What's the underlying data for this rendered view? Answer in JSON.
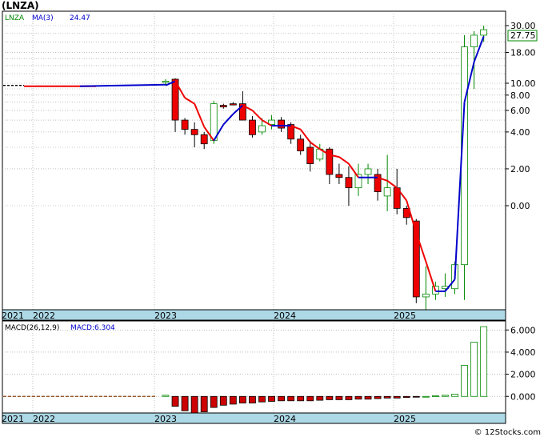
{
  "page": {
    "title": "(LNZA)",
    "copyright": "© 12Stocks.com"
  },
  "chart_data": [
    {
      "type": "candlestick",
      "ticker_label": "LNZA",
      "ma_label": "MA(3)",
      "ma_value": "24.47",
      "last_price": "27.75",
      "y_scale": "log",
      "y_ticks": [
        {
          "label": "30.00",
          "v": 30
        },
        {
          "label": "18.00",
          "v": 18
        },
        {
          "label": "10.00",
          "v": 10
        },
        {
          "label": "8.00",
          "v": 8
        },
        {
          "label": "6.00",
          "v": 6
        },
        {
          "label": "4.00",
          "v": 4
        },
        {
          "label": "2.00",
          "v": 2
        },
        {
          "label": "0.00",
          "v": 1
        }
      ],
      "x_ticks": [
        "2021",
        "2022",
        "2023",
        "2024",
        "2025"
      ],
      "flat_price_2021_2022": 9.6,
      "candles": [
        {
          "o": 10.2,
          "h": 10.8,
          "l": 9.6,
          "c": 10.4
        },
        {
          "o": 10.8,
          "h": 11.0,
          "l": 4.0,
          "c": 5.0
        },
        {
          "o": 5.0,
          "h": 5.2,
          "l": 3.8,
          "c": 4.2
        },
        {
          "o": 4.2,
          "h": 4.8,
          "l": 3.0,
          "c": 3.8
        },
        {
          "o": 3.8,
          "h": 4.0,
          "l": 2.9,
          "c": 3.2
        },
        {
          "o": 3.4,
          "h": 7.2,
          "l": 3.2,
          "c": 6.8
        },
        {
          "o": 6.6,
          "h": 6.8,
          "l": 6.2,
          "c": 6.4
        },
        {
          "o": 6.8,
          "h": 7.0,
          "l": 6.6,
          "c": 6.7
        },
        {
          "o": 6.8,
          "h": 8.6,
          "l": 5.0,
          "c": 5.0
        },
        {
          "o": 5.0,
          "h": 5.4,
          "l": 3.6,
          "c": 3.8
        },
        {
          "o": 4.0,
          "h": 5.2,
          "l": 3.8,
          "c": 4.5
        },
        {
          "o": 4.6,
          "h": 5.5,
          "l": 4.2,
          "c": 5.0
        },
        {
          "o": 5.0,
          "h": 5.3,
          "l": 4.0,
          "c": 4.3
        },
        {
          "o": 4.6,
          "h": 4.8,
          "l": 3.2,
          "c": 3.5
        },
        {
          "o": 3.5,
          "h": 3.8,
          "l": 2.6,
          "c": 2.8
        },
        {
          "o": 3.0,
          "h": 3.4,
          "l": 1.9,
          "c": 2.2
        },
        {
          "o": 2.4,
          "h": 3.2,
          "l": 2.3,
          "c": 2.9
        },
        {
          "o": 2.9,
          "h": 3.0,
          "l": 1.5,
          "c": 1.8
        },
        {
          "o": 1.8,
          "h": 2.2,
          "l": 1.5,
          "c": 1.7
        },
        {
          "o": 1.7,
          "h": 2.1,
          "l": 1.0,
          "c": 1.4
        },
        {
          "o": 1.4,
          "h": 2.2,
          "l": 1.2,
          "c": 1.8
        },
        {
          "o": 1.8,
          "h": 2.2,
          "l": 1.5,
          "c": 2.0
        },
        {
          "o": 1.8,
          "h": 2.0,
          "l": 1.1,
          "c": 1.3
        },
        {
          "o": 1.2,
          "h": 2.6,
          "l": 0.9,
          "c": 1.4
        },
        {
          "o": 1.4,
          "h": 2.0,
          "l": 0.85,
          "c": 0.95
        },
        {
          "o": 0.95,
          "h": 1.0,
          "l": 0.7,
          "c": 0.8
        },
        {
          "o": 0.75,
          "h": 0.78,
          "l": 0.16,
          "c": 0.18
        },
        {
          "o": 0.18,
          "h": 0.32,
          "l": 0.13,
          "c": 0.19
        },
        {
          "o": 0.19,
          "h": 0.24,
          "l": 0.17,
          "c": 0.22
        },
        {
          "o": 0.21,
          "h": 0.28,
          "l": 0.18,
          "c": 0.22
        },
        {
          "o": 0.21,
          "h": 0.35,
          "l": 0.19,
          "c": 0.33
        },
        {
          "o": 0.33,
          "h": 25.0,
          "l": 0.17,
          "c": 20.0
        },
        {
          "o": 20.0,
          "h": 27.0,
          "l": 9.0,
          "c": 25.0
        },
        {
          "o": 25.0,
          "h": 30.0,
          "l": 22.0,
          "c": 27.75
        }
      ],
      "ma_line": [
        9.6,
        10.4,
        7.6,
        6.8,
        4.4,
        3.4,
        4.6,
        5.6,
        6.6,
        6.0,
        5.0,
        4.5,
        4.5,
        4.5,
        4.2,
        3.3,
        2.9,
        2.6,
        2.5,
        2.2,
        1.7,
        1.7,
        1.7,
        1.6,
        1.4,
        1.1,
        0.6,
        0.35,
        0.2,
        0.2,
        0.25,
        7.0,
        15.0,
        24.47
      ],
      "up_color": "#ffffff",
      "down_color": "#ee0000",
      "ma_down_color": "#ee0000",
      "ma_up_color": "#0000cc"
    },
    {
      "type": "bar",
      "title": "MACD(26,12,9)",
      "macd_label": "MACD:6.304",
      "y_ticks": [
        "6.000",
        "4.000",
        "2.000",
        "0.000"
      ],
      "ylim": [
        -1.5,
        6.6
      ],
      "flat_value": 0.0,
      "values": [
        0.1,
        -0.9,
        -1.3,
        -1.5,
        -1.4,
        -1.0,
        -0.8,
        -0.7,
        -0.6,
        -0.6,
        -0.5,
        -0.45,
        -0.4,
        -0.4,
        -0.4,
        -0.4,
        -0.35,
        -0.3,
        -0.3,
        -0.3,
        -0.25,
        -0.25,
        -0.2,
        -0.15,
        -0.15,
        -0.1,
        -0.05,
        0.0,
        0.05,
        0.1,
        0.2,
        2.8,
        4.9,
        6.304
      ],
      "up_color": "#008800",
      "down_color": "#cc0000"
    }
  ]
}
